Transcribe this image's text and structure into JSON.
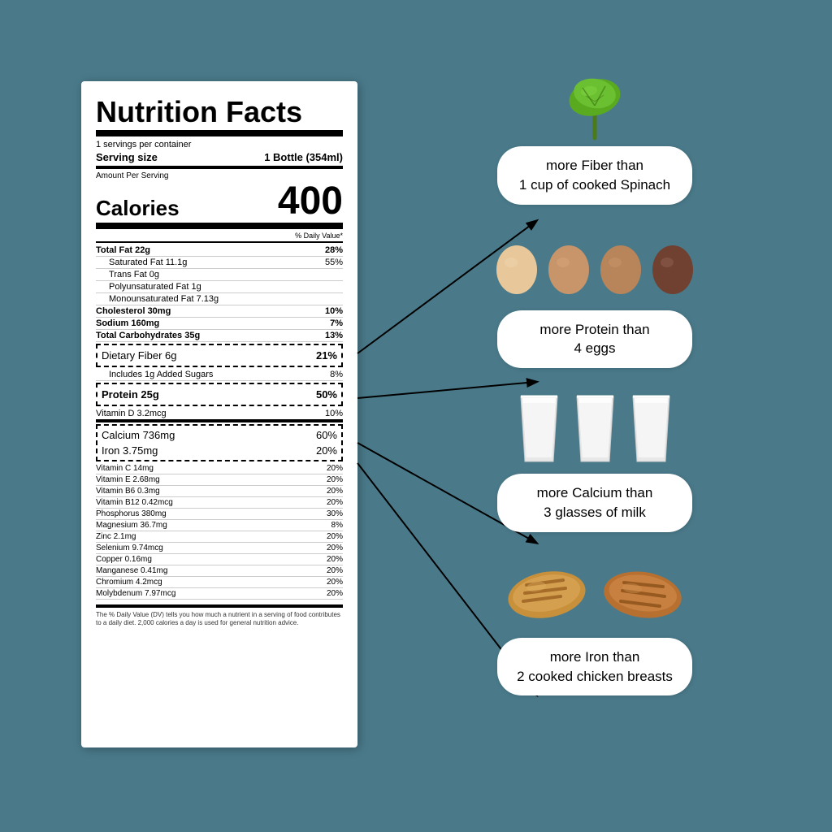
{
  "background_color": "#4a7a8a",
  "nutrition": {
    "title": "Nutrition Facts",
    "servings_per_container": "1 servings per container",
    "serving_size_label": "Serving size",
    "serving_size_value": "1 Bottle (354ml)",
    "amount_per_serving": "Amount Per Serving",
    "calories_label": "Calories",
    "calories_value": "400",
    "daily_value_header": "% Daily Value*",
    "nutrients": [
      {
        "label": "Total Fat 22g",
        "value": "28%",
        "bold": true,
        "indented": false
      },
      {
        "label": "Saturated Fat 11.1g",
        "value": "55%",
        "bold": false,
        "indented": true
      },
      {
        "label": "Trans Fat 0g",
        "value": "",
        "bold": false,
        "indented": true
      },
      {
        "label": "Polyunsaturated Fat 1g",
        "value": "",
        "bold": false,
        "indented": true
      },
      {
        "label": "Monounsaturated Fat 7.13g",
        "value": "",
        "bold": false,
        "indented": true
      },
      {
        "label": "Cholesterol 30mg",
        "value": "10%",
        "bold": true,
        "indented": false
      },
      {
        "label": "Sodium 160mg",
        "value": "7%",
        "bold": true,
        "indented": false
      },
      {
        "label": "Total Carbohydrates 35g",
        "value": "13%",
        "bold": true,
        "indented": false
      }
    ],
    "highlighted_nutrients": [
      {
        "label": "Dietary Fiber 6g",
        "value": "21%"
      },
      {
        "label": "Protein 25g",
        "value": "50%",
        "bold": true
      }
    ],
    "added_sugars": {
      "label": "Includes 1g Added Sugars",
      "value": "8%"
    },
    "vitamin_d": {
      "label": "Vitamin D 3.2mcg",
      "value": "10%"
    },
    "boxed_nutrients": [
      {
        "label": "Calcium 736mg",
        "value": "60%"
      },
      {
        "label": "Iron 3.75mg",
        "value": "20%"
      }
    ],
    "additional_nutrients": [
      {
        "label": "Vitamin C 14mg",
        "value": "20%"
      },
      {
        "label": "Vitamin E 2.68mg",
        "value": "20%"
      },
      {
        "label": "Vitamin B6 0.3mg",
        "value": "20%"
      },
      {
        "label": "Vitamin B12 0.42mcg",
        "value": "20%"
      },
      {
        "label": "Phosphorus 380mg",
        "value": "30%"
      },
      {
        "label": "Magnesium 36.7mg",
        "value": "8%"
      },
      {
        "label": "Zinc 2.1mg",
        "value": "20%"
      },
      {
        "label": "Selenium 9.74mcg",
        "value": "20%"
      },
      {
        "label": "Copper 0.16mg",
        "value": "20%"
      },
      {
        "label": "Manganese 0.41mg",
        "value": "20%"
      },
      {
        "label": "Chromium 4.2mcg",
        "value": "20%"
      },
      {
        "label": "Molybdenum 7.97mcg",
        "value": "20%"
      }
    ],
    "footnote": "The % Daily Value (DV) tells you how much a nutrient in a serving of food contributes to a daily diet. 2,000 calories a day is used for general nutrition advice."
  },
  "comparisons": [
    {
      "id": "fiber",
      "text_line1": "more Fiber than",
      "text_line2": "1 cup of cooked Spinach"
    },
    {
      "id": "protein",
      "text_line1": "more Protein than",
      "text_line2": "4 eggs"
    },
    {
      "id": "calcium",
      "text_line1": "more Calcium than",
      "text_line2": "3 glasses of milk"
    },
    {
      "id": "iron",
      "text_line1": "more Iron than",
      "text_line2": "2 cooked chicken breasts"
    }
  ]
}
